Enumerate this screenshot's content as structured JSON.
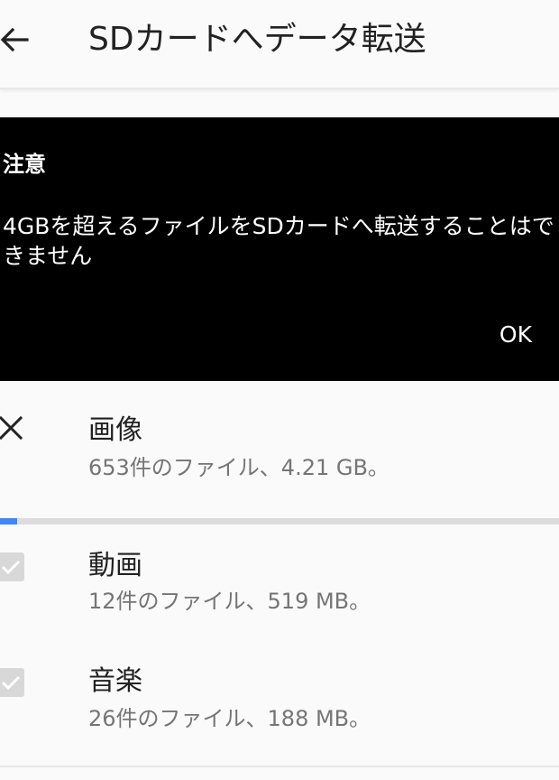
{
  "header": {
    "title": "SDカードへデータ転送",
    "back_icon": "arrow-left-icon"
  },
  "dialog": {
    "title": "注意",
    "message": "4GBを超えるファイルをSDカードへ転送することはできません",
    "ok_label": "OK",
    "background": "#000000"
  },
  "items": [
    {
      "title": "画像",
      "subtitle": "653件のファイル、4.21 GB。",
      "state": "cancel",
      "icon": "close-icon",
      "progress": 0.03
    },
    {
      "title": "動画",
      "subtitle": "12件のファイル、519 MB。",
      "state": "checked-disabled",
      "icon": "check-icon"
    },
    {
      "title": "音楽",
      "subtitle": "26件のファイル、188 MB。",
      "state": "checked-disabled",
      "icon": "check-icon"
    }
  ],
  "colors": {
    "accent": "#4285f4",
    "track": "#dcdcdc",
    "subtext": "#757575"
  }
}
